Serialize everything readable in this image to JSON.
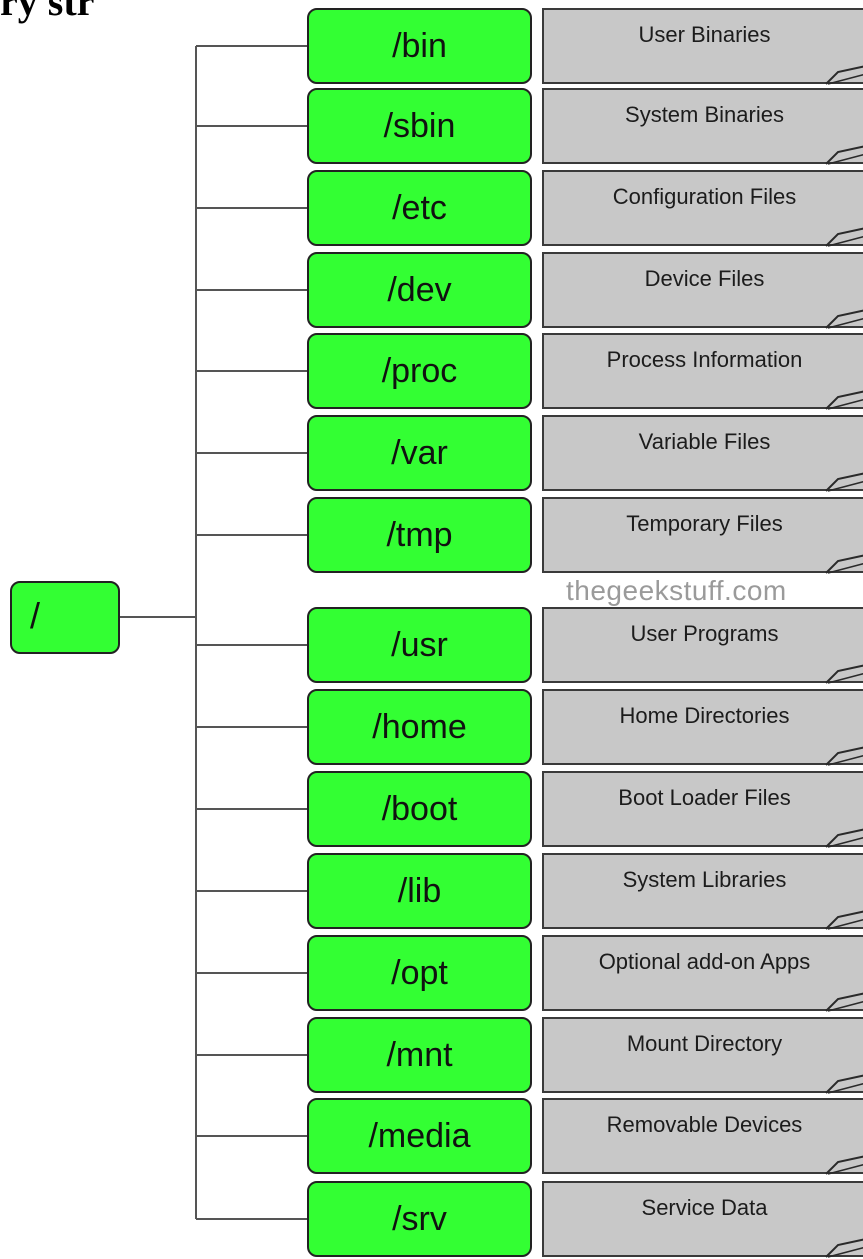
{
  "heading": "ry str",
  "watermark": "thegeekstuff.com",
  "root": {
    "label": "/"
  },
  "directories": [
    {
      "path": "/bin",
      "description": "User Binaries"
    },
    {
      "path": "/sbin",
      "description": "System Binaries"
    },
    {
      "path": "/etc",
      "description": "Configuration Files"
    },
    {
      "path": "/dev",
      "description": "Device Files"
    },
    {
      "path": "/proc",
      "description": "Process Information"
    },
    {
      "path": "/var",
      "description": "Variable Files"
    },
    {
      "path": "/tmp",
      "description": "Temporary Files"
    },
    {
      "path": "/usr",
      "description": "User Programs"
    },
    {
      "path": "/home",
      "description": "Home Directories"
    },
    {
      "path": "/boot",
      "description": "Boot Loader Files"
    },
    {
      "path": "/lib",
      "description": "System Libraries"
    },
    {
      "path": "/opt",
      "description": "Optional add-on Apps"
    },
    {
      "path": "/mnt",
      "description": "Mount Directory"
    },
    {
      "path": "/media",
      "description": "Removable Devices"
    },
    {
      "path": "/srv",
      "description": "Service Data"
    }
  ],
  "colors": {
    "directory_fill": "#33ff33",
    "description_fill": "#c8c8c8",
    "line": "#555555"
  }
}
